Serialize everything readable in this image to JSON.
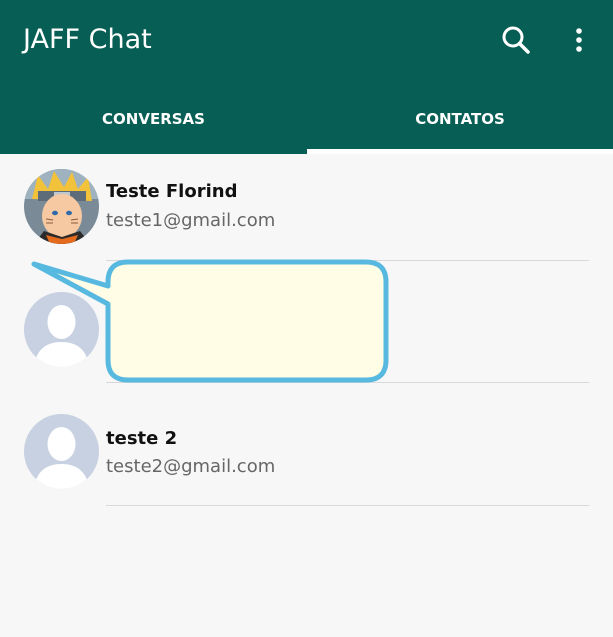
{
  "app": {
    "title": "JAFF Chat"
  },
  "header": {
    "icons": [
      "search-icon",
      "more-vertical-icon"
    ]
  },
  "tabs": [
    {
      "label": "CONVERSAS",
      "selected": false
    },
    {
      "label": "CONTATOS",
      "selected": true
    }
  ],
  "contacts": [
    {
      "name": "Teste Florind",
      "email": "teste1@gmail.com",
      "avatar": "anime-character-avatar"
    },
    {
      "name": "",
      "email": "",
      "avatar": "default-person-avatar"
    },
    {
      "name": "teste 2",
      "email": "teste2@gmail.com",
      "avatar": "default-person-avatar"
    }
  ],
  "colors": {
    "primary": "#075e54",
    "background": "#f7f7f7",
    "callout_fill": "#fffde6",
    "callout_border": "#58b9e0",
    "avatar_placeholder": "#c8d1e1"
  }
}
